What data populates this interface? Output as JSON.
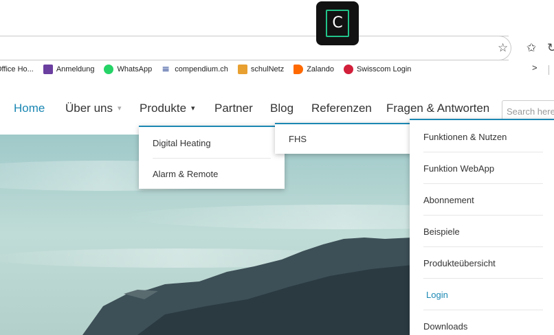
{
  "browser": {
    "bookmarks": [
      {
        "label": "Office Ho...",
        "color": "#ffffff"
      },
      {
        "label": "Anmeldung",
        "color": "#6b3fa0"
      },
      {
        "label": "WhatsApp",
        "color": "#25d366"
      },
      {
        "label": "compendium.ch",
        "color": "#1d3b8f"
      },
      {
        "label": "schulNetz",
        "color": "#e8a030"
      },
      {
        "label": "Zalando",
        "color": "#ff6900"
      },
      {
        "label": "Swisscom Login",
        "color": "#d21f3a"
      }
    ],
    "more_chevron": ">"
  },
  "app_icon_letter": "C",
  "nav": {
    "home": "Home",
    "ueber_uns": "Über uns",
    "produkte": "Produkte",
    "partner": "Partner",
    "blog": "Blog",
    "referenzen": "Referenzen",
    "fragen": "Fragen & Antworten",
    "search_placeholder": "Search here"
  },
  "produkte_menu": [
    "Digital Heating",
    "Alarm & Remote"
  ],
  "submenu_level2": [
    "FHS"
  ],
  "submenu_level3": [
    "Funktionen & Nutzen",
    "Funktion WebApp",
    "Abonnement",
    "Beispiele",
    "Produkteübersicht",
    "Login",
    "Downloads"
  ],
  "active_submenu_item": "Login",
  "colors": {
    "accent": "#1a87b3",
    "app_icon_bg": "#121212",
    "app_icon_border": "#21c48a"
  }
}
